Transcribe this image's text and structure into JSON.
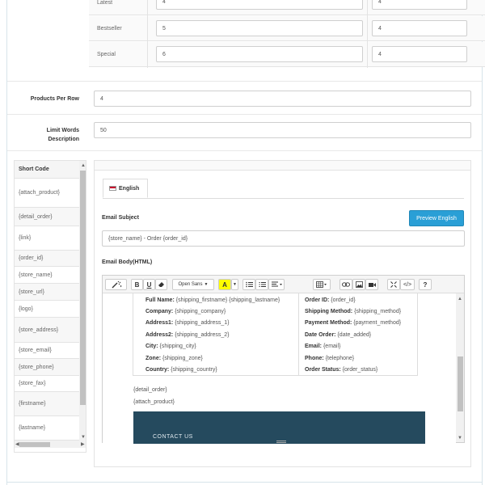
{
  "top_table": {
    "rows": [
      {
        "label": "Latest",
        "value1": "4",
        "value2": "4"
      },
      {
        "label": "Bestseller",
        "value1": "5",
        "value2": "4"
      },
      {
        "label": "Special",
        "value1": "6",
        "value2": "4"
      }
    ]
  },
  "settings": {
    "products_per_row_label": "Products Per Row",
    "products_per_row_value": "4",
    "limit_words_label_line1": "Limit Words",
    "limit_words_label_line2": "Description",
    "limit_words_value": "50"
  },
  "short_codes": {
    "header": "Short Code",
    "items": [
      "{attach_product}",
      "{detail_order}",
      "{link}",
      "{order_id}",
      "{store_name}",
      "{store_url}",
      "{logo}",
      "{store_address}",
      "{store_email}",
      "{store_phone}",
      "{store_fax}",
      "{firstname}",
      "{lastname}"
    ]
  },
  "email_panel": {
    "tab_label": "English",
    "subject_label": "Email Subject",
    "preview_button": "Preview English",
    "subject_value": "{store_name} - Order {order_id}",
    "body_label": "Email Body(HTML)",
    "toolbar": {
      "magic": "magic-wand-icon",
      "bold": "B",
      "underline": "U",
      "eraser": "eraser-icon",
      "font_name": "Open Sans",
      "font_color": "A",
      "code": "</>",
      "help": "?"
    },
    "address_left": [
      {
        "key": "Full Name:",
        "val": "{shipping_firstname} {shipping_lastname}"
      },
      {
        "key": "Company:",
        "val": "{shipping_company}"
      },
      {
        "key": "Address1:",
        "val": "{shipping_address_1}"
      },
      {
        "key": "Address2:",
        "val": "{shipping_address_2}"
      },
      {
        "key": "City:",
        "val": "{shipping_city}"
      },
      {
        "key": "Zone:",
        "val": "{shipping_zone}"
      },
      {
        "key": "Country:",
        "val": "{shipping_country}"
      }
    ],
    "address_right": [
      {
        "key": "Order ID:",
        "val": "{order_id}"
      },
      {
        "key": "Shipping Method:",
        "val": "{shipping_method}"
      },
      {
        "key": "Payment Method:",
        "val": "{payment_method}"
      },
      {
        "key": "Date Order:",
        "val": "{date_added}"
      },
      {
        "key": "Email:",
        "val": "{email}"
      },
      {
        "key": "Phone:",
        "val": "{telephone}"
      },
      {
        "key": "Order Status:",
        "val": "{order_status}"
      }
    ],
    "body_line1": "{detail_order}",
    "body_line2": "{attach_product}",
    "footer_text": "CONTACT US"
  },
  "colors": {
    "primary_button": "#2a9fd6",
    "footer_block": "#254a5e"
  }
}
